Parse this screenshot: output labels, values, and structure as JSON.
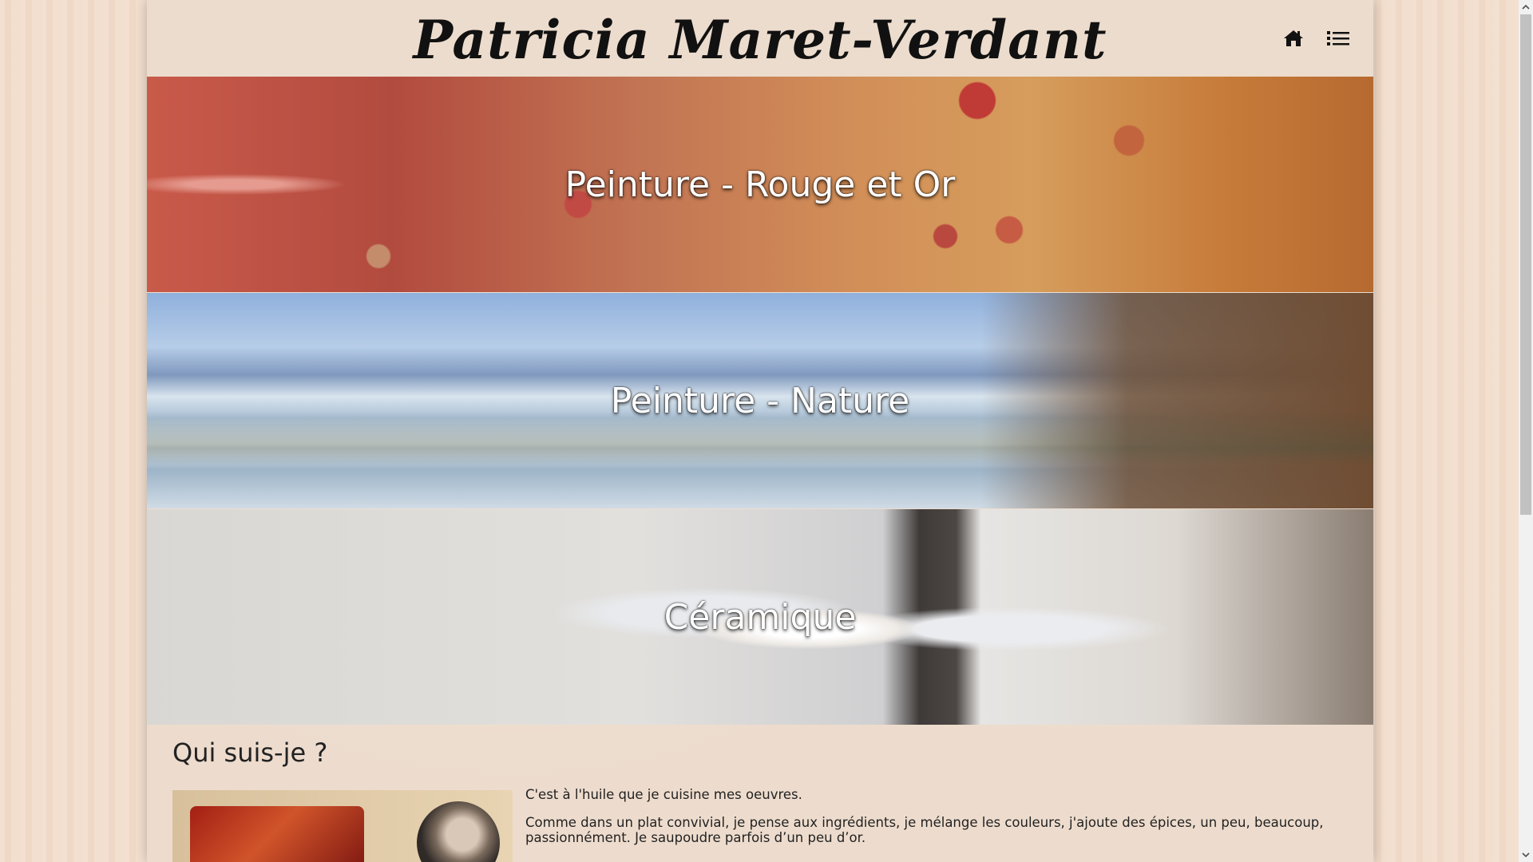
{
  "site": {
    "title": "Patricia Maret-Verdant"
  },
  "nav": {
    "home_icon": "home-icon",
    "menu_icon": "list-menu-icon"
  },
  "banners": [
    {
      "label": "Peinture - Rouge et Or"
    },
    {
      "label": "Peinture - Nature"
    },
    {
      "label": "Céramique"
    }
  ],
  "about": {
    "title": "Qui suis-je ?",
    "paragraphs": [
      "C'est à l'huile que je cuisine mes oeuvres.",
      "Comme dans un plat convivial, je pense aux ingrédients, je mélange les couleurs, j'ajoute des épices, un peu, beaucoup, passionnément. Je saupoudre parfois d’un peu d’or."
    ]
  },
  "colors": {
    "background": "#f2ddcc",
    "page": "#eddccd",
    "title_text": "#111111"
  }
}
